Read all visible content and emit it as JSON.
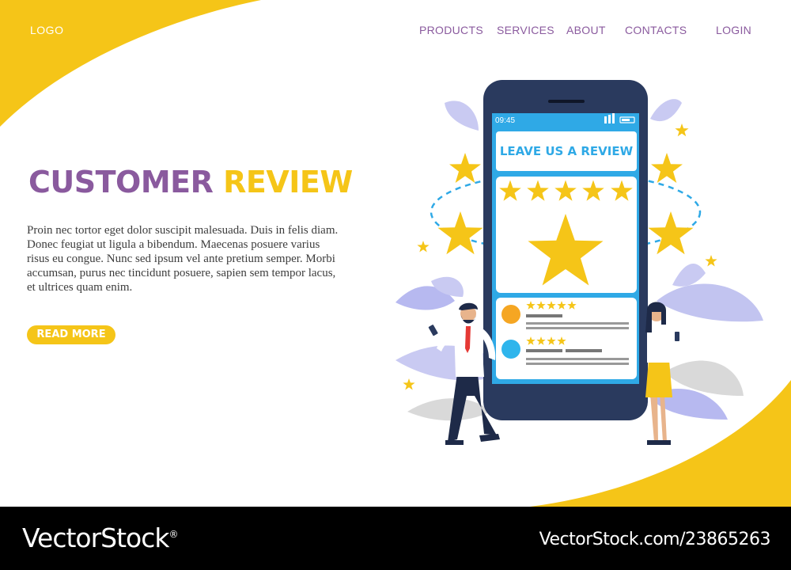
{
  "header": {
    "logo": "LOGO",
    "nav": [
      "PRODUCTS",
      "SERVICES",
      "ABOUT",
      "CONTACTS",
      "LOGIN"
    ]
  },
  "hero": {
    "title_part1": "CUSTOMER",
    "title_part2": "REVIEW",
    "body": "Proin nec tortor eget dolor suscipit malesuada. Duis in felis diam. Donec feugiat ut ligula a bibendum. Maecenas posuere varius risus eu congue. Nunc sed ipsum vel ante pretium semper. Morbi accumsan, purus nec tincidunt posuere, sapien sem tempor lacus, et ultrices quam enim.",
    "button": "READ MORE"
  },
  "phone": {
    "time": "09:45",
    "heading": "LEAVE US A REVIEW",
    "rating_stars": 5,
    "reviews": [
      {
        "avatar_color": "#f5a623",
        "stars": 5
      },
      {
        "avatar_color": "#2fb5ec",
        "stars": 4
      }
    ]
  },
  "footer": {
    "brand": "VectorStock",
    "brand_mark": "®",
    "url": "VectorStock.com/23865263"
  },
  "colors": {
    "accent_yellow": "#f5c518",
    "accent_purple": "#8a5a9e",
    "phone_blue": "#2fa9e6",
    "phone_body": "#2a3a5e",
    "footer_bg": "#000000"
  }
}
